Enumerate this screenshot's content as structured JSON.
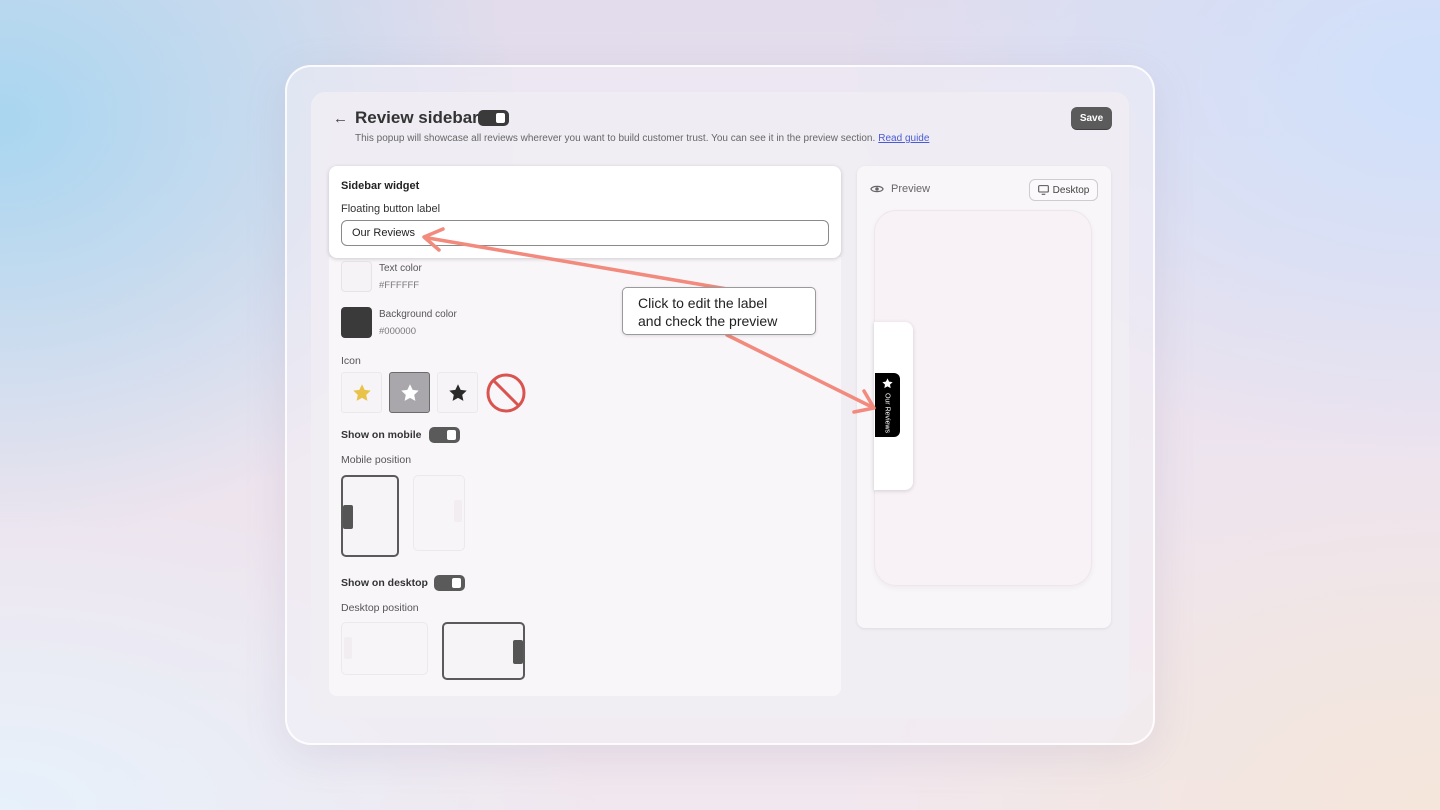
{
  "header": {
    "title": "Review sidebar",
    "subtitle": "This popup will showcase all reviews wherever you want to build customer trust. You can see it in the preview section.",
    "guide_link": "Read guide",
    "save_label": "Save"
  },
  "widget": {
    "section_title": "Sidebar widget",
    "field_label": "Floating button label",
    "field_value": "Our Reviews"
  },
  "colors": {
    "text_color_label": "Text color",
    "text_color_value": "#FFFFFF",
    "background_color_label": "Background color",
    "background_color_value": "#000000"
  },
  "icon": {
    "label": "Icon",
    "options": [
      "star-yellow-icon",
      "star-white-icon",
      "star-black-icon",
      "no-icon"
    ],
    "selected": "star-white-icon"
  },
  "mobile": {
    "toggle_label": "Show on mobile",
    "enabled": true,
    "position_label": "Mobile position",
    "selected_position": "left"
  },
  "desktop": {
    "toggle_label": "Show on desktop",
    "enabled": true,
    "position_label": "Desktop position",
    "selected_position": "right"
  },
  "preview": {
    "label": "Preview",
    "device_button": "Desktop",
    "floating_label": "Our Reviews"
  },
  "callout": {
    "line1": "Click to edit the label",
    "line2": "and check the preview"
  },
  "accent": {
    "arrow_color": "#f28a7d",
    "no_icon_color": "#d9534f",
    "star_yellow": "#e9c349"
  }
}
